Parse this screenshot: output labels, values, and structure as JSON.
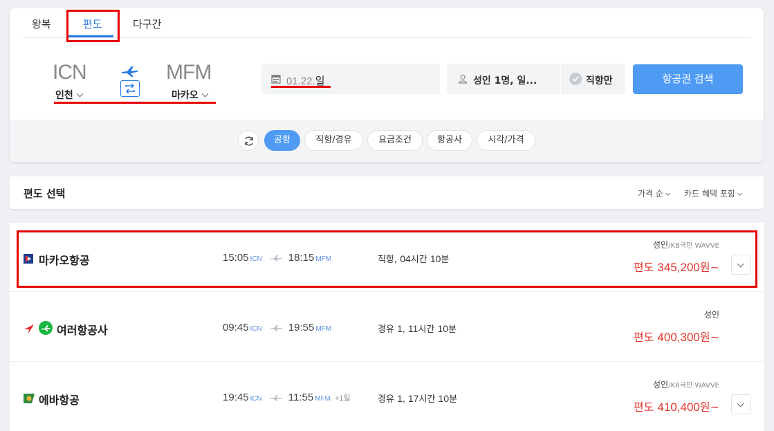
{
  "tabs": [
    {
      "label": "왕복"
    },
    {
      "label": "편도"
    },
    {
      "label": "다구간"
    }
  ],
  "route": {
    "origin_code": "ICN",
    "origin_city": "인천",
    "dest_code": "MFM",
    "dest_city": "마카오"
  },
  "date": {
    "value": "01.22.",
    "weekday": "일"
  },
  "passengers": {
    "label": "성인 1명, 일..."
  },
  "direct_only": {
    "label": "직항만"
  },
  "search_button": {
    "label": "항공권 검색"
  },
  "filters": [
    {
      "label": "공항",
      "active": true
    },
    {
      "label": "직항/경유"
    },
    {
      "label": "요금조건"
    },
    {
      "label": "항공사"
    },
    {
      "label": "시각/가격"
    }
  ],
  "results_header": {
    "title": "편도 선택",
    "sort_price": "가격 순",
    "sort_card": "카드 혜택 포함"
  },
  "flights": [
    {
      "airline": "마카오항공",
      "depart_time": "15:05",
      "depart_code": "ICN",
      "arrive_time": "18:15",
      "arrive_code": "MFM",
      "plus_day": "",
      "stop_type": "직항,",
      "hours": "04",
      "hours_unit": "시간",
      "minutes": "10",
      "minutes_unit": "분",
      "fare_pax": "성인",
      "fare_card": "/KB국민 WAVVE",
      "price_prefix": "편도",
      "price": "345,200",
      "price_unit": "원~"
    },
    {
      "airline": "여러항공사",
      "depart_time": "09:45",
      "depart_code": "ICN",
      "arrive_time": "19:55",
      "arrive_code": "MFM",
      "plus_day": "",
      "stop_type": "경유",
      "stop_count": "1,",
      "hours": "11",
      "hours_unit": "시간",
      "minutes": "10",
      "minutes_unit": "분",
      "fare_pax": "성인",
      "fare_card": "",
      "price_prefix": "편도",
      "price": "400,300",
      "price_unit": "원~"
    },
    {
      "airline": "에바항공",
      "depart_time": "19:45",
      "depart_code": "ICN",
      "arrive_time": "11:55",
      "arrive_code": "MFM",
      "plus_day": "+1일",
      "stop_type": "경유",
      "stop_count": "1,",
      "hours": "17",
      "hours_unit": "시간",
      "minutes": "10",
      "minutes_unit": "분",
      "fare_pax": "성인",
      "fare_card": "/KB국민 WAVVE",
      "price_prefix": "편도",
      "price": "410,400",
      "price_unit": "원~"
    }
  ],
  "colors": {
    "accent": "#2a7be4",
    "button": "#4f9bf3",
    "price": "#e0362c",
    "highlight": "#e60000"
  }
}
